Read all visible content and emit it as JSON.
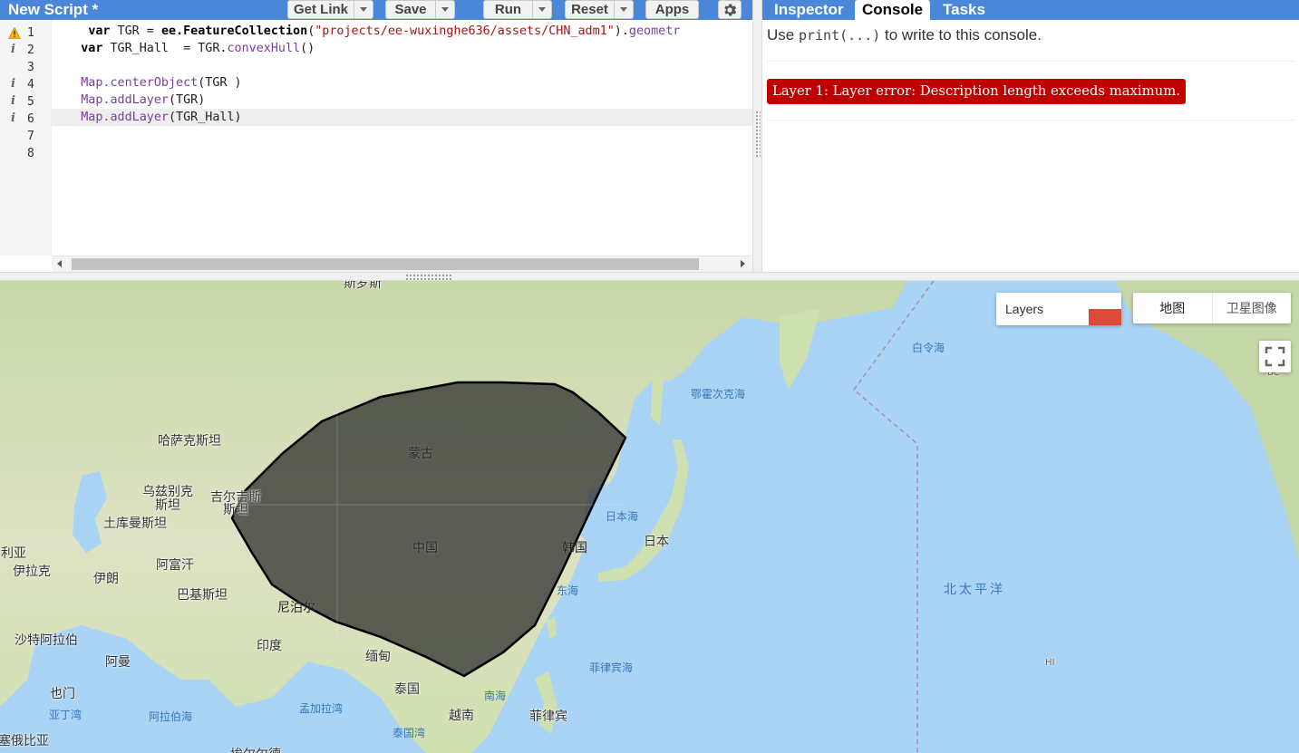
{
  "editor": {
    "title": "New Script *",
    "buttons": [
      {
        "label": "Get Link"
      },
      {
        "label": "Save"
      },
      {
        "label": "Run"
      },
      {
        "label": "Reset"
      },
      {
        "label": "Apps"
      }
    ],
    "lines": [
      {
        "num": "1",
        "marker": "warning",
        "tokens": [
          [
            "pl",
            " "
          ],
          [
            "kw",
            "var"
          ],
          [
            "pl",
            " TGR = "
          ],
          [
            "kw",
            "ee.FeatureCollection"
          ],
          [
            "pl",
            "("
          ],
          [
            "str",
            "\"projects/ee-wuxinghe636/assets/CHN_adm1\""
          ],
          [
            "pl",
            ")."
          ],
          [
            "fn",
            "geometr"
          ]
        ]
      },
      {
        "num": "2",
        "marker": "info",
        "tokens": [
          [
            "kw",
            "var"
          ],
          [
            "pl",
            " TGR_Hall  = TGR."
          ],
          [
            "fn",
            "convexHull"
          ],
          [
            "pl",
            "()"
          ]
        ]
      },
      {
        "num": "3",
        "marker": "",
        "tokens": []
      },
      {
        "num": "4",
        "marker": "info",
        "tokens": [
          [
            "fn",
            "Map.centerObject"
          ],
          [
            "pl",
            "(TGR )"
          ]
        ]
      },
      {
        "num": "5",
        "marker": "info",
        "tokens": [
          [
            "fn",
            "Map.addLayer"
          ],
          [
            "pl",
            "(TGR)"
          ]
        ]
      },
      {
        "num": "6",
        "marker": "info",
        "active": true,
        "tokens": [
          [
            "fn",
            "Map.addLayer"
          ],
          [
            "pl",
            "(TGR_Hall)"
          ]
        ]
      },
      {
        "num": "7",
        "marker": "",
        "tokens": []
      },
      {
        "num": "8",
        "marker": "",
        "tokens": []
      }
    ]
  },
  "right_panel": {
    "tabs": [
      {
        "label": "Inspector",
        "selected": false
      },
      {
        "label": "Console",
        "selected": true
      },
      {
        "label": "Tasks",
        "selected": false
      }
    ],
    "hint_before": "Use ",
    "hint_code": "print(...)",
    "hint_after": " to write to this console.",
    "error": "Layer 1: Layer error: Description length exceeds maximum."
  },
  "map": {
    "layers_label": "Layers",
    "layer_swatch_color": "#dc4a38",
    "maptype_buttons": [
      "地图",
      "卫星图像"
    ],
    "labels": {
      "kazakhstan": "哈萨克斯坦",
      "uzbekistan_1": "乌兹别克",
      "uzbekistan_2": "斯坦",
      "kyrgyzstan_1": "吉尔吉斯",
      "kyrgyzstan_2": "斯坦",
      "turkmenistan": "土库曼斯坦",
      "syria": "利亚",
      "iraq": "伊拉克",
      "iran": "伊朗",
      "afghanistan": "阿富汗",
      "pakistan": "巴基斯坦",
      "nepal": "尼泊尔",
      "india": "印度",
      "saudi": "沙特阿拉伯",
      "oman": "阿曼",
      "yemen": "也门",
      "gulf_aden": "亚丁湾",
      "arabian_sea": "阿拉伯海",
      "bay_bengal": "孟加拉湾",
      "ethiopia": "塞俄比亚",
      "mongolia": "蒙古",
      "china": "中国",
      "korea": "韩国",
      "japan": "日本",
      "sea_japan": "日本海",
      "east_sea": "东海",
      "okhotsk": "鄂霍次克海",
      "bering": "白令海",
      "north_pacific": "北太平洋",
      "philippine_sea": "菲律宾海",
      "myanmar": "缅甸",
      "thailand": "泰国",
      "vietnam": "越南",
      "philippines": "菲律宾",
      "south_sea": "南海",
      "gulf_thailand": "泰国湾",
      "hi": "HI",
      "bc": "BC",
      "top_partial": "斯罗斯",
      "bottom_partial": "埃尔尔德"
    }
  }
}
